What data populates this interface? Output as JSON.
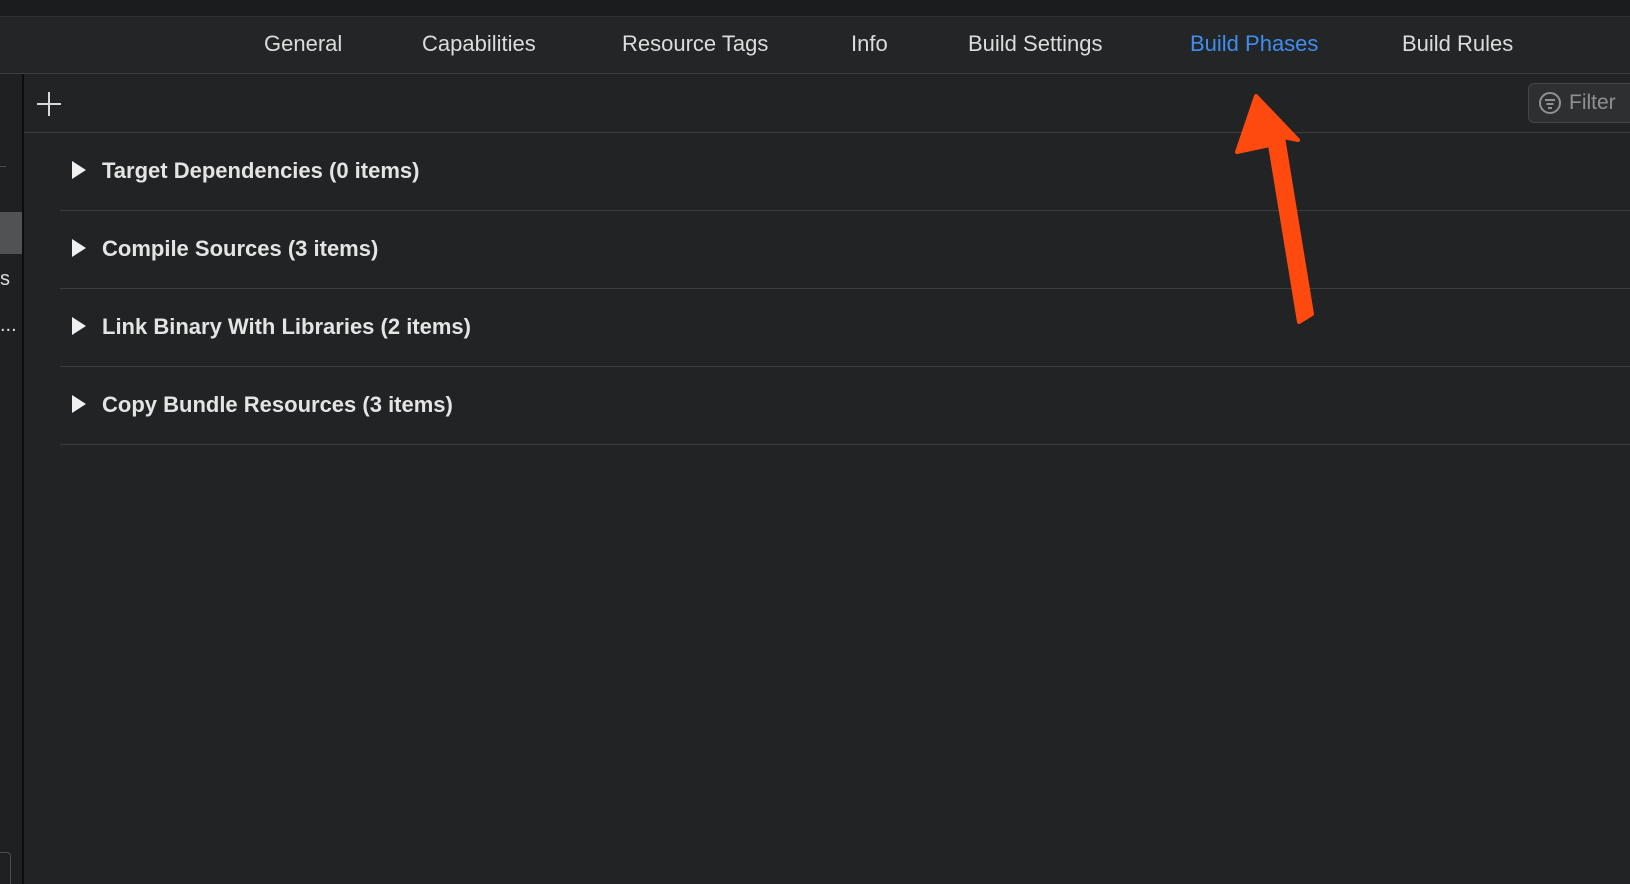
{
  "tabs": [
    {
      "label": "General",
      "active": false
    },
    {
      "label": "Capabilities",
      "active": false
    },
    {
      "label": "Resource Tags",
      "active": false
    },
    {
      "label": "Info",
      "active": false
    },
    {
      "label": "Build Settings",
      "active": false
    },
    {
      "label": "Build Phases",
      "active": true
    },
    {
      "label": "Build Rules",
      "active": false
    }
  ],
  "toolbar": {
    "add_icon": "plus-icon",
    "filter": {
      "placeholder": "Filter",
      "icon": "filter-icon"
    }
  },
  "sidebar": {
    "fragments": [
      "s",
      "..."
    ]
  },
  "phases": [
    {
      "label": "Target Dependencies (0 items)",
      "expanded": false
    },
    {
      "label": "Compile Sources (3 items)",
      "expanded": false
    },
    {
      "label": "Link Binary With Libraries (2 items)",
      "expanded": false
    },
    {
      "label": "Copy Bundle Resources (3 items)",
      "expanded": false
    }
  ],
  "annotation": {
    "type": "arrow",
    "color": "#fe4a0f",
    "points_to": "Build Phases"
  },
  "colors": {
    "background": "#212324",
    "active_tab": "#3e8ef0",
    "text": "#e4e4e4"
  }
}
